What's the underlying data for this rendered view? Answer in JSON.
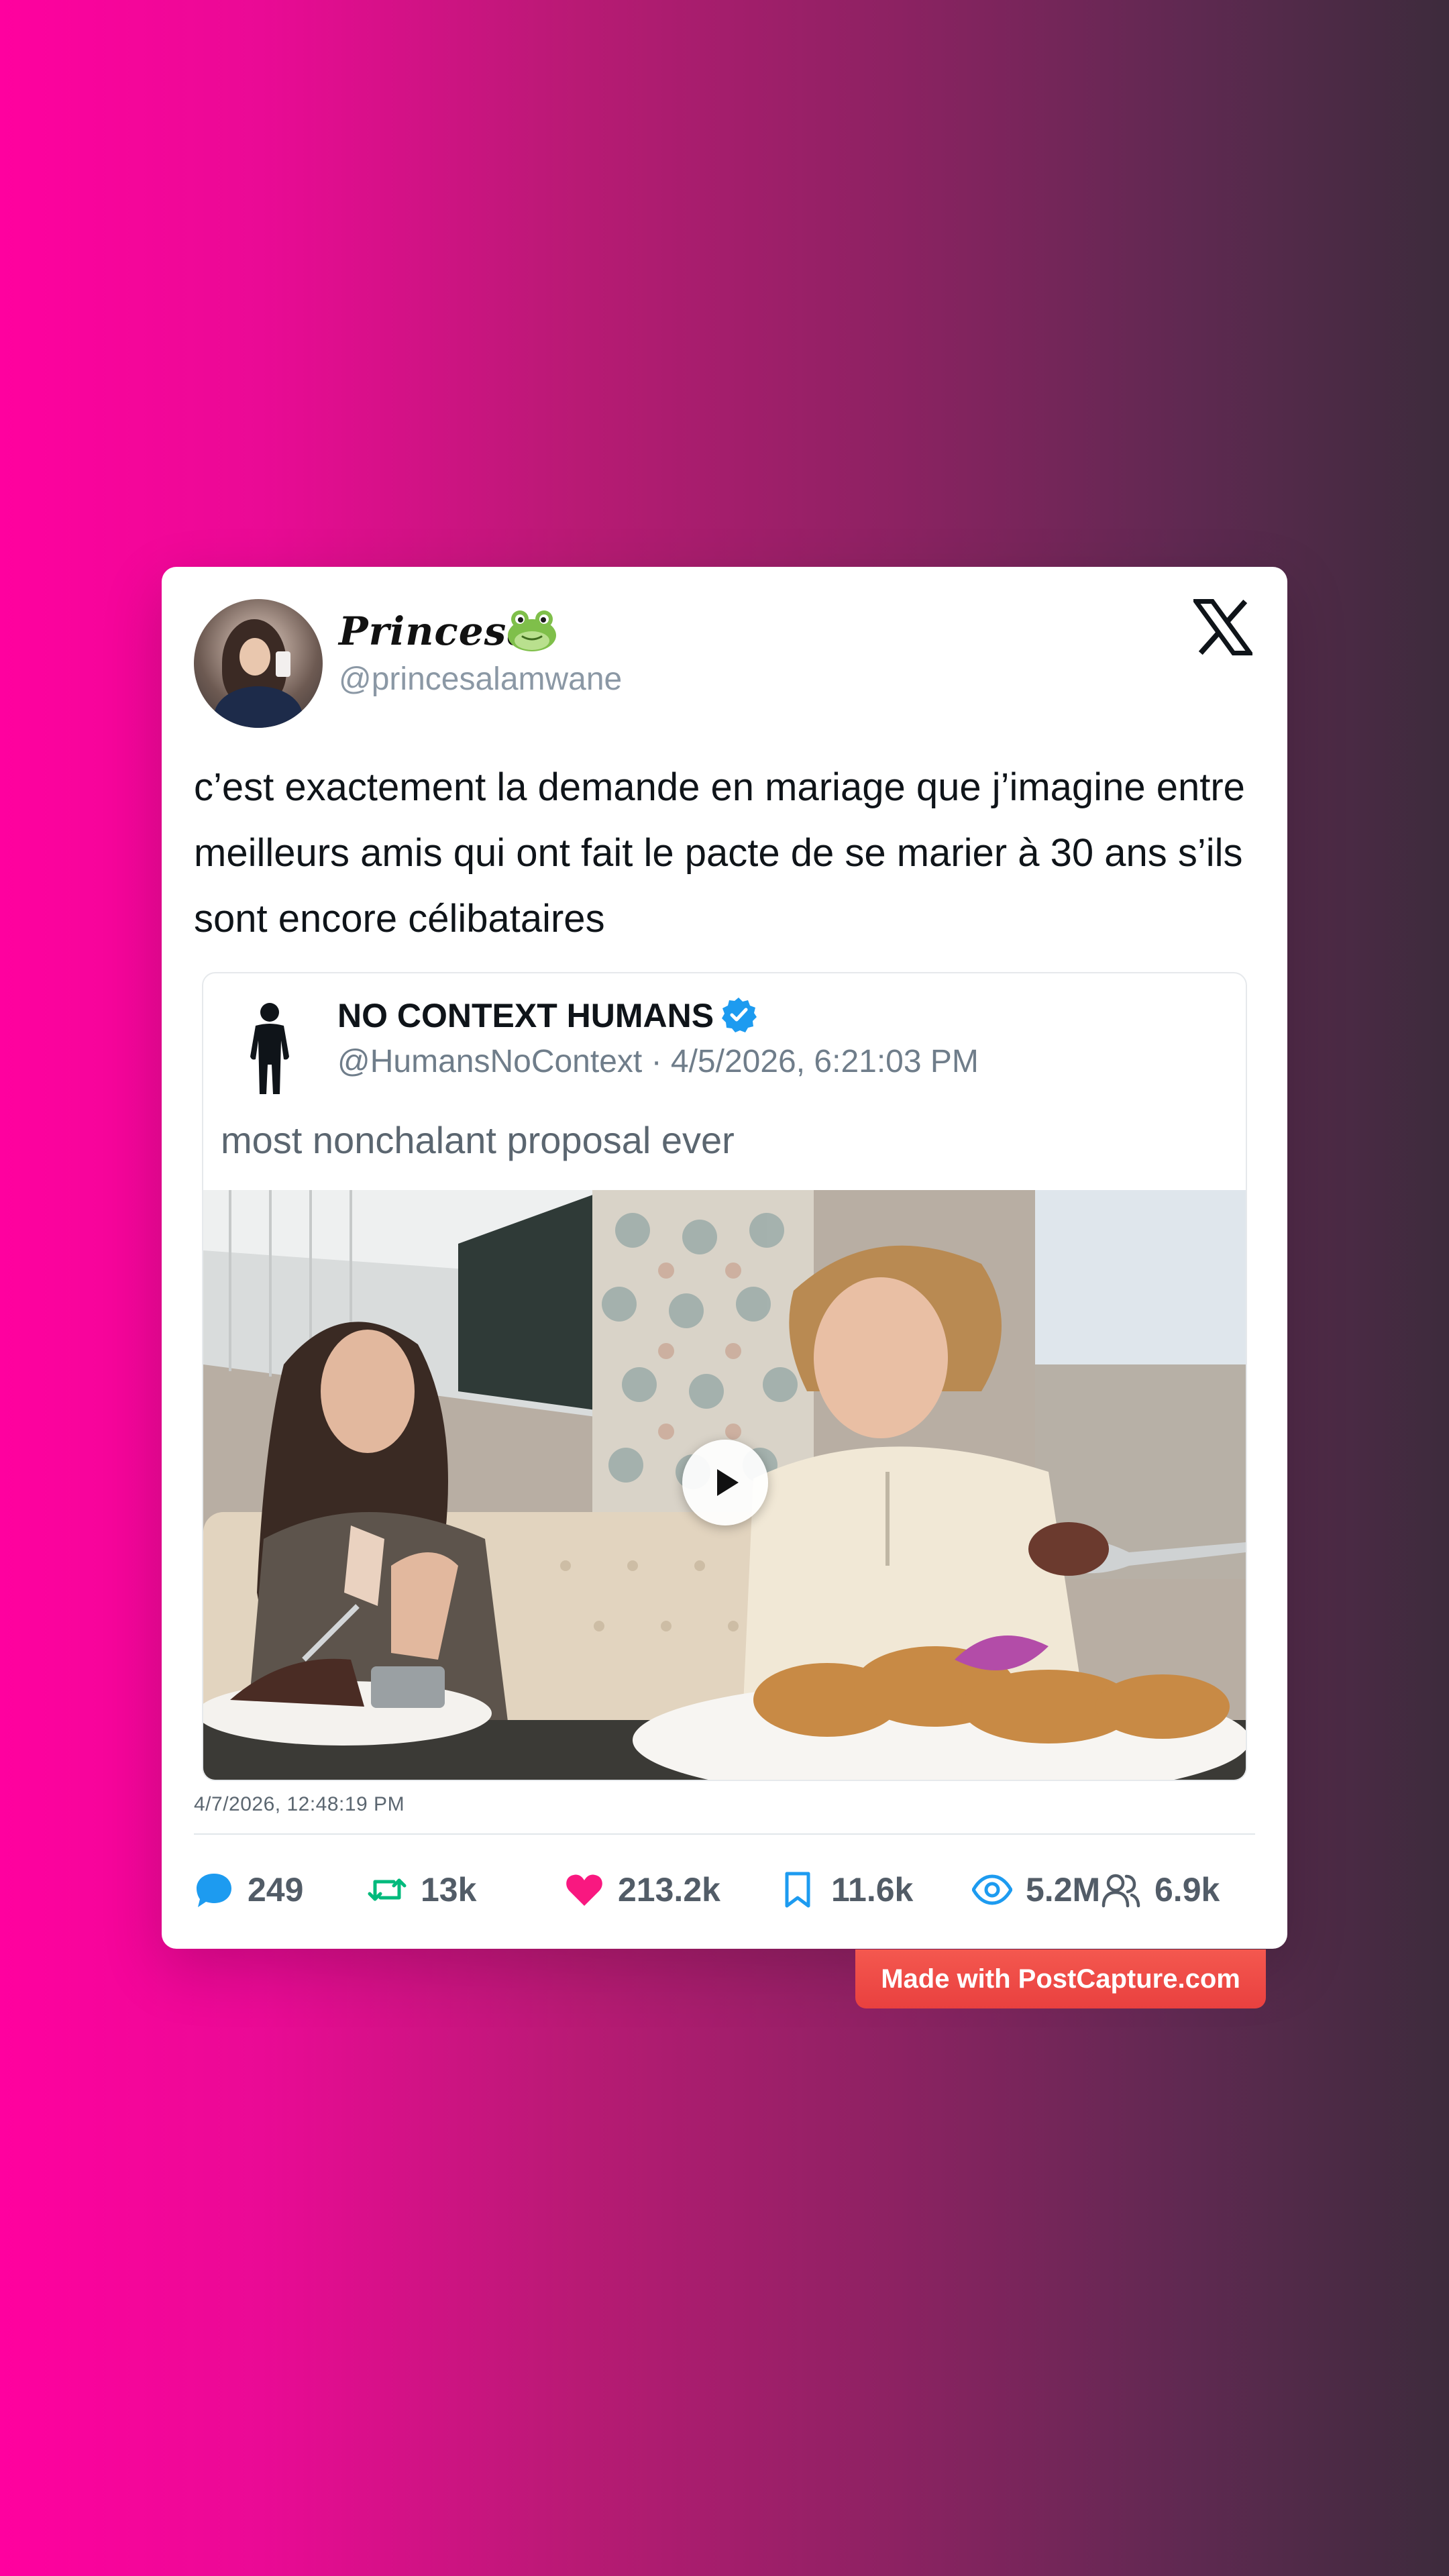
{
  "author": {
    "display_name": "Princesa",
    "emoji": "frog-emoji",
    "handle": "@princesalamwane"
  },
  "tweet": {
    "text": "c’est exactement la demande en mariage que j’imagine entre meilleurs amis qui ont fait le pacte de se marier à 30 ans s’ils sont encore célibataires",
    "timestamp": "4/7/2026, 12:48:19 PM"
  },
  "quoted": {
    "name": "NO CONTEXT HUMANS",
    "verified": true,
    "meta": "@HumansNoContext · 4/5/2026, 6:21:03 PM",
    "text": "most nonchalant proposal ever",
    "media": {
      "type": "video",
      "icon": "play-icon"
    }
  },
  "stats": {
    "replies": "249",
    "retweets": "13k",
    "likes": "213.2k",
    "bookmarks": "11.6k",
    "views": "5.2M",
    "followers": "6.9k"
  },
  "watermark": "Made with PostCapture.com",
  "colors": {
    "reply": "#1d9bf0",
    "retweet": "#00ba7c",
    "like": "#f91880",
    "bookmark": "#1d9bf0",
    "views": "#1d9bf0",
    "followers": "#525c67",
    "badge": "#e9403f",
    "verified": "#1d9bf0"
  }
}
